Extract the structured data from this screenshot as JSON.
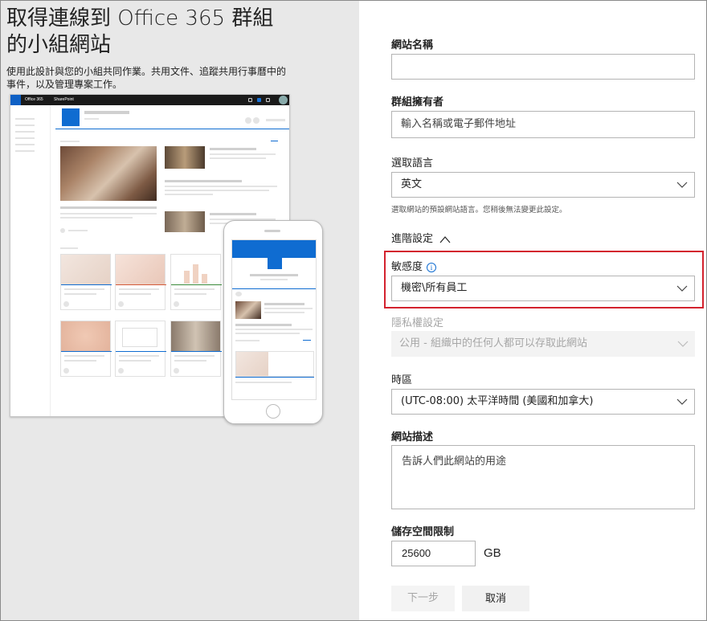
{
  "left": {
    "title_line1": "取得連線到 Office 365 群組",
    "title_line2": "的小組網站",
    "description_line1": "使用此設計與您的小組共同作業。共用文件、追蹤共用行事曆中的",
    "description_line2": "事件，以及管理專案工作。",
    "preview": {
      "suite_app": "Office 365",
      "suite_product": "SharePoint"
    }
  },
  "form": {
    "site_name": {
      "label": "網站名稱",
      "value": ""
    },
    "group_owner": {
      "label": "群組擁有者",
      "placeholder": "輸入名稱或電子郵件地址"
    },
    "language": {
      "label": "選取語言",
      "value": "英文",
      "hint": "選取網站的預設網站語言。您稍後無法變更此設定。"
    },
    "advanced": {
      "label": "進階設定"
    },
    "sensitivity": {
      "label": "敏感度",
      "info_glyph": "i",
      "value": "機密\\所有員工"
    },
    "privacy": {
      "label": "隱私權設定",
      "value": "公用 - 組織中的任何人都可以存取此網站"
    },
    "time_zone": {
      "label": "時區",
      "value": "(UTC-08:00) 太平洋時間 (美國和加拿大)"
    },
    "site_description": {
      "label": "網站描述",
      "placeholder": "告訴人們此網站的用途"
    },
    "storage_limit": {
      "label": "儲存空間限制",
      "value": "25600",
      "unit": "GB"
    },
    "buttons": {
      "next": "下一步",
      "cancel": "取消"
    }
  },
  "colors": {
    "highlight": "#d3222e",
    "accent": "#0f6cd1",
    "left_panel": "#e8e8e8"
  }
}
